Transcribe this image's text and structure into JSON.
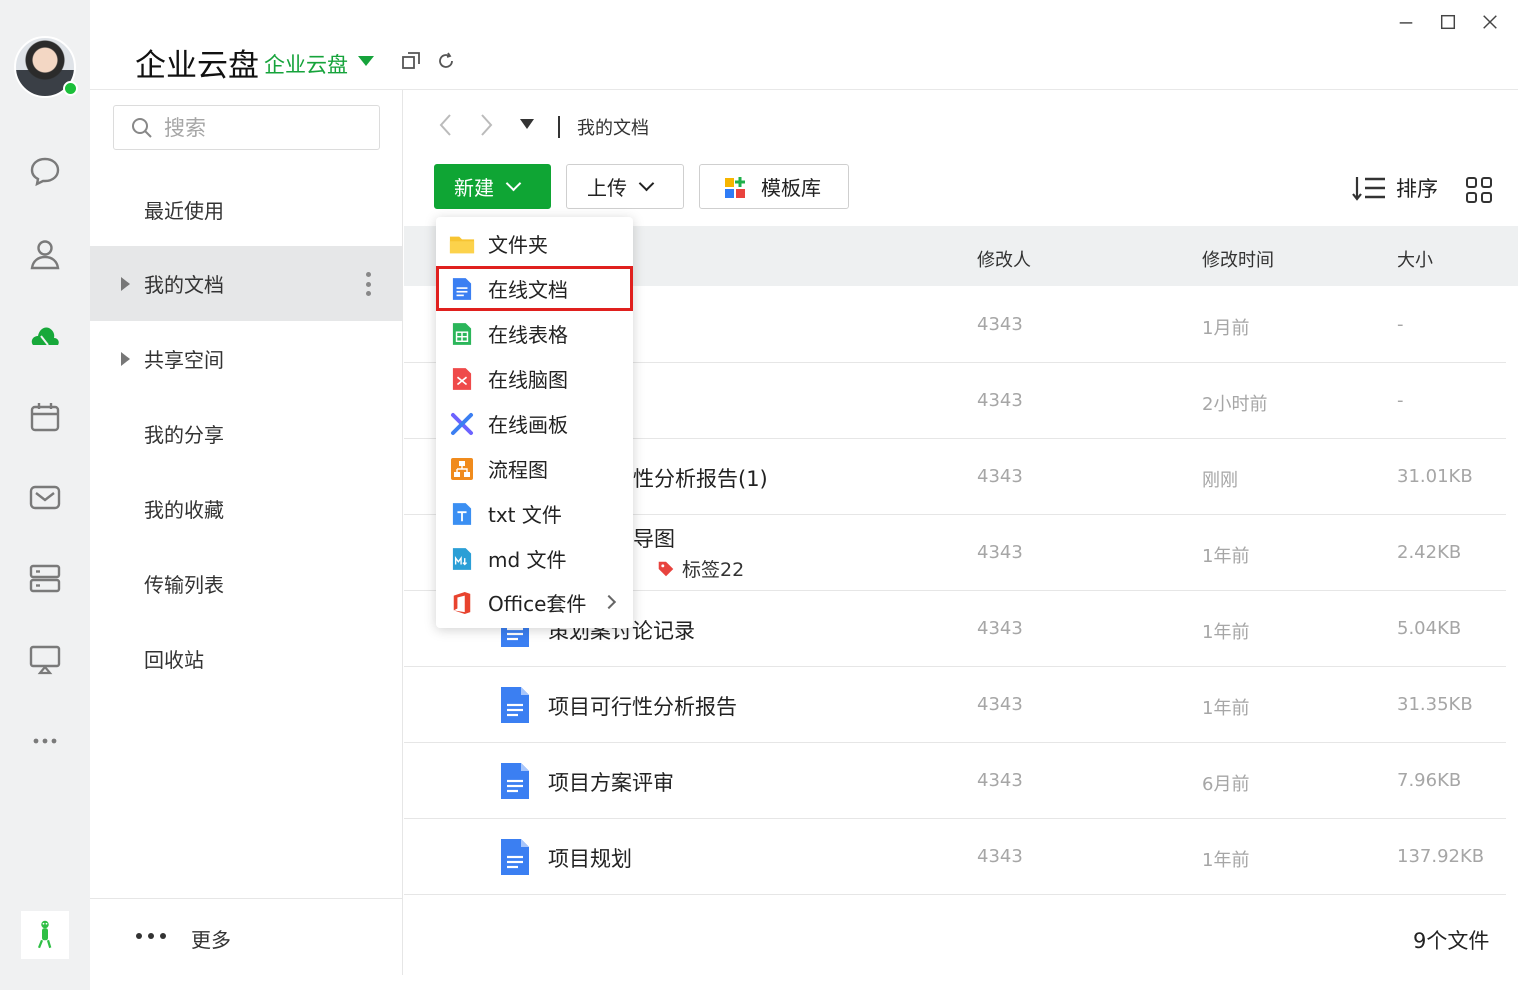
{
  "header": {
    "title": "企业云盘",
    "subtitle": "企业云盘"
  },
  "search": {
    "placeholder": "搜索"
  },
  "sidebar": {
    "items": [
      {
        "label": "最近使用"
      },
      {
        "label": "我的文档"
      },
      {
        "label": "共享空间"
      },
      {
        "label": "我的分享"
      },
      {
        "label": "我的收藏"
      },
      {
        "label": "传输列表"
      },
      {
        "label": "回收站"
      }
    ],
    "more_label": "更多"
  },
  "breadcrumb": {
    "current": "我的文档"
  },
  "toolbar": {
    "new_label": "新建",
    "upload_label": "上传",
    "template_label": "模板库",
    "sort_label": "排序"
  },
  "table": {
    "headers": {
      "modifier": "修改人",
      "modified": "修改时间",
      "size": "大小"
    },
    "rows": [
      {
        "name": "",
        "modifier": "4343",
        "modified": "1月前",
        "size": "-"
      },
      {
        "name": "",
        "modifier": "4343",
        "modified": "2小时前",
        "size": "-"
      },
      {
        "name": "性分析报告(1)",
        "modifier": "4343",
        "modified": "刚刚",
        "size": "31.01KB"
      },
      {
        "name": "导图",
        "modifier": "4343",
        "modified": "1年前",
        "size": "2.42KB",
        "tag": "标签22"
      },
      {
        "name": "策划案讨论记录",
        "modifier": "4343",
        "modified": "1年前",
        "size": "5.04KB"
      },
      {
        "name": "项目可行性分析报告",
        "modifier": "4343",
        "modified": "1年前",
        "size": "31.35KB"
      },
      {
        "name": "项目方案评审",
        "modifier": "4343",
        "modified": "6月前",
        "size": "7.96KB"
      },
      {
        "name": "项目规划",
        "modifier": "4343",
        "modified": "1年前",
        "size": "137.92KB"
      }
    ],
    "file_count": "9个文件"
  },
  "new_menu": {
    "items": [
      {
        "label": "文件夹"
      },
      {
        "label": "在线文档"
      },
      {
        "label": "在线表格"
      },
      {
        "label": "在线脑图"
      },
      {
        "label": "在线画板"
      },
      {
        "label": "流程图"
      },
      {
        "label": "txt 文件"
      },
      {
        "label": "md 文件"
      },
      {
        "label": "Office套件"
      }
    ]
  },
  "colors": {
    "accent": "#0fa534",
    "highlight": "#e0201e"
  }
}
